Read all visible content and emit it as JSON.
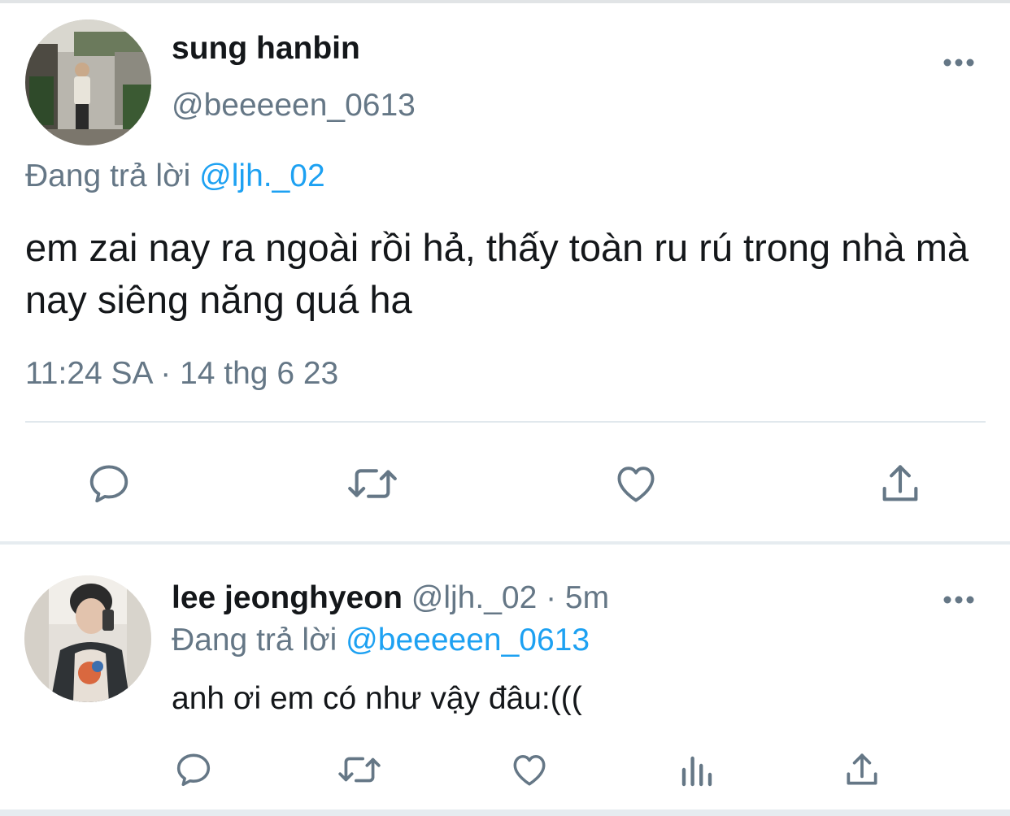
{
  "main_tweet": {
    "display_name": "sung hanbin",
    "handle": "@beeeeen_0613",
    "reply_context_prefix": "Đang trả lời",
    "reply_to": "@ljh._02",
    "text": "em zai nay ra ngoài rồi hả, thấy toàn ru rú trong nhà mà nay siêng năng quá ha",
    "timestamp": "11:24 SA · 14 thg 6 23",
    "actions": [
      "reply-icon",
      "retweet-icon",
      "like-icon",
      "share-icon"
    ]
  },
  "reply_tweet": {
    "display_name": "lee jeonghyeon",
    "meta": "@ljh._02 · 5m",
    "reply_context_prefix": "Đang trả lời",
    "reply_to": "@beeeeen_0613",
    "text": "anh ơi em có như vậy đâu:(((",
    "actions": [
      "reply-icon",
      "retweet-icon",
      "like-icon",
      "analytics-icon",
      "share-icon"
    ]
  },
  "colors": {
    "text_primary": "#14171a",
    "text_secondary": "#657786",
    "link": "#1da1f2",
    "icon": "#657786",
    "divider": "#e1e8ed"
  }
}
